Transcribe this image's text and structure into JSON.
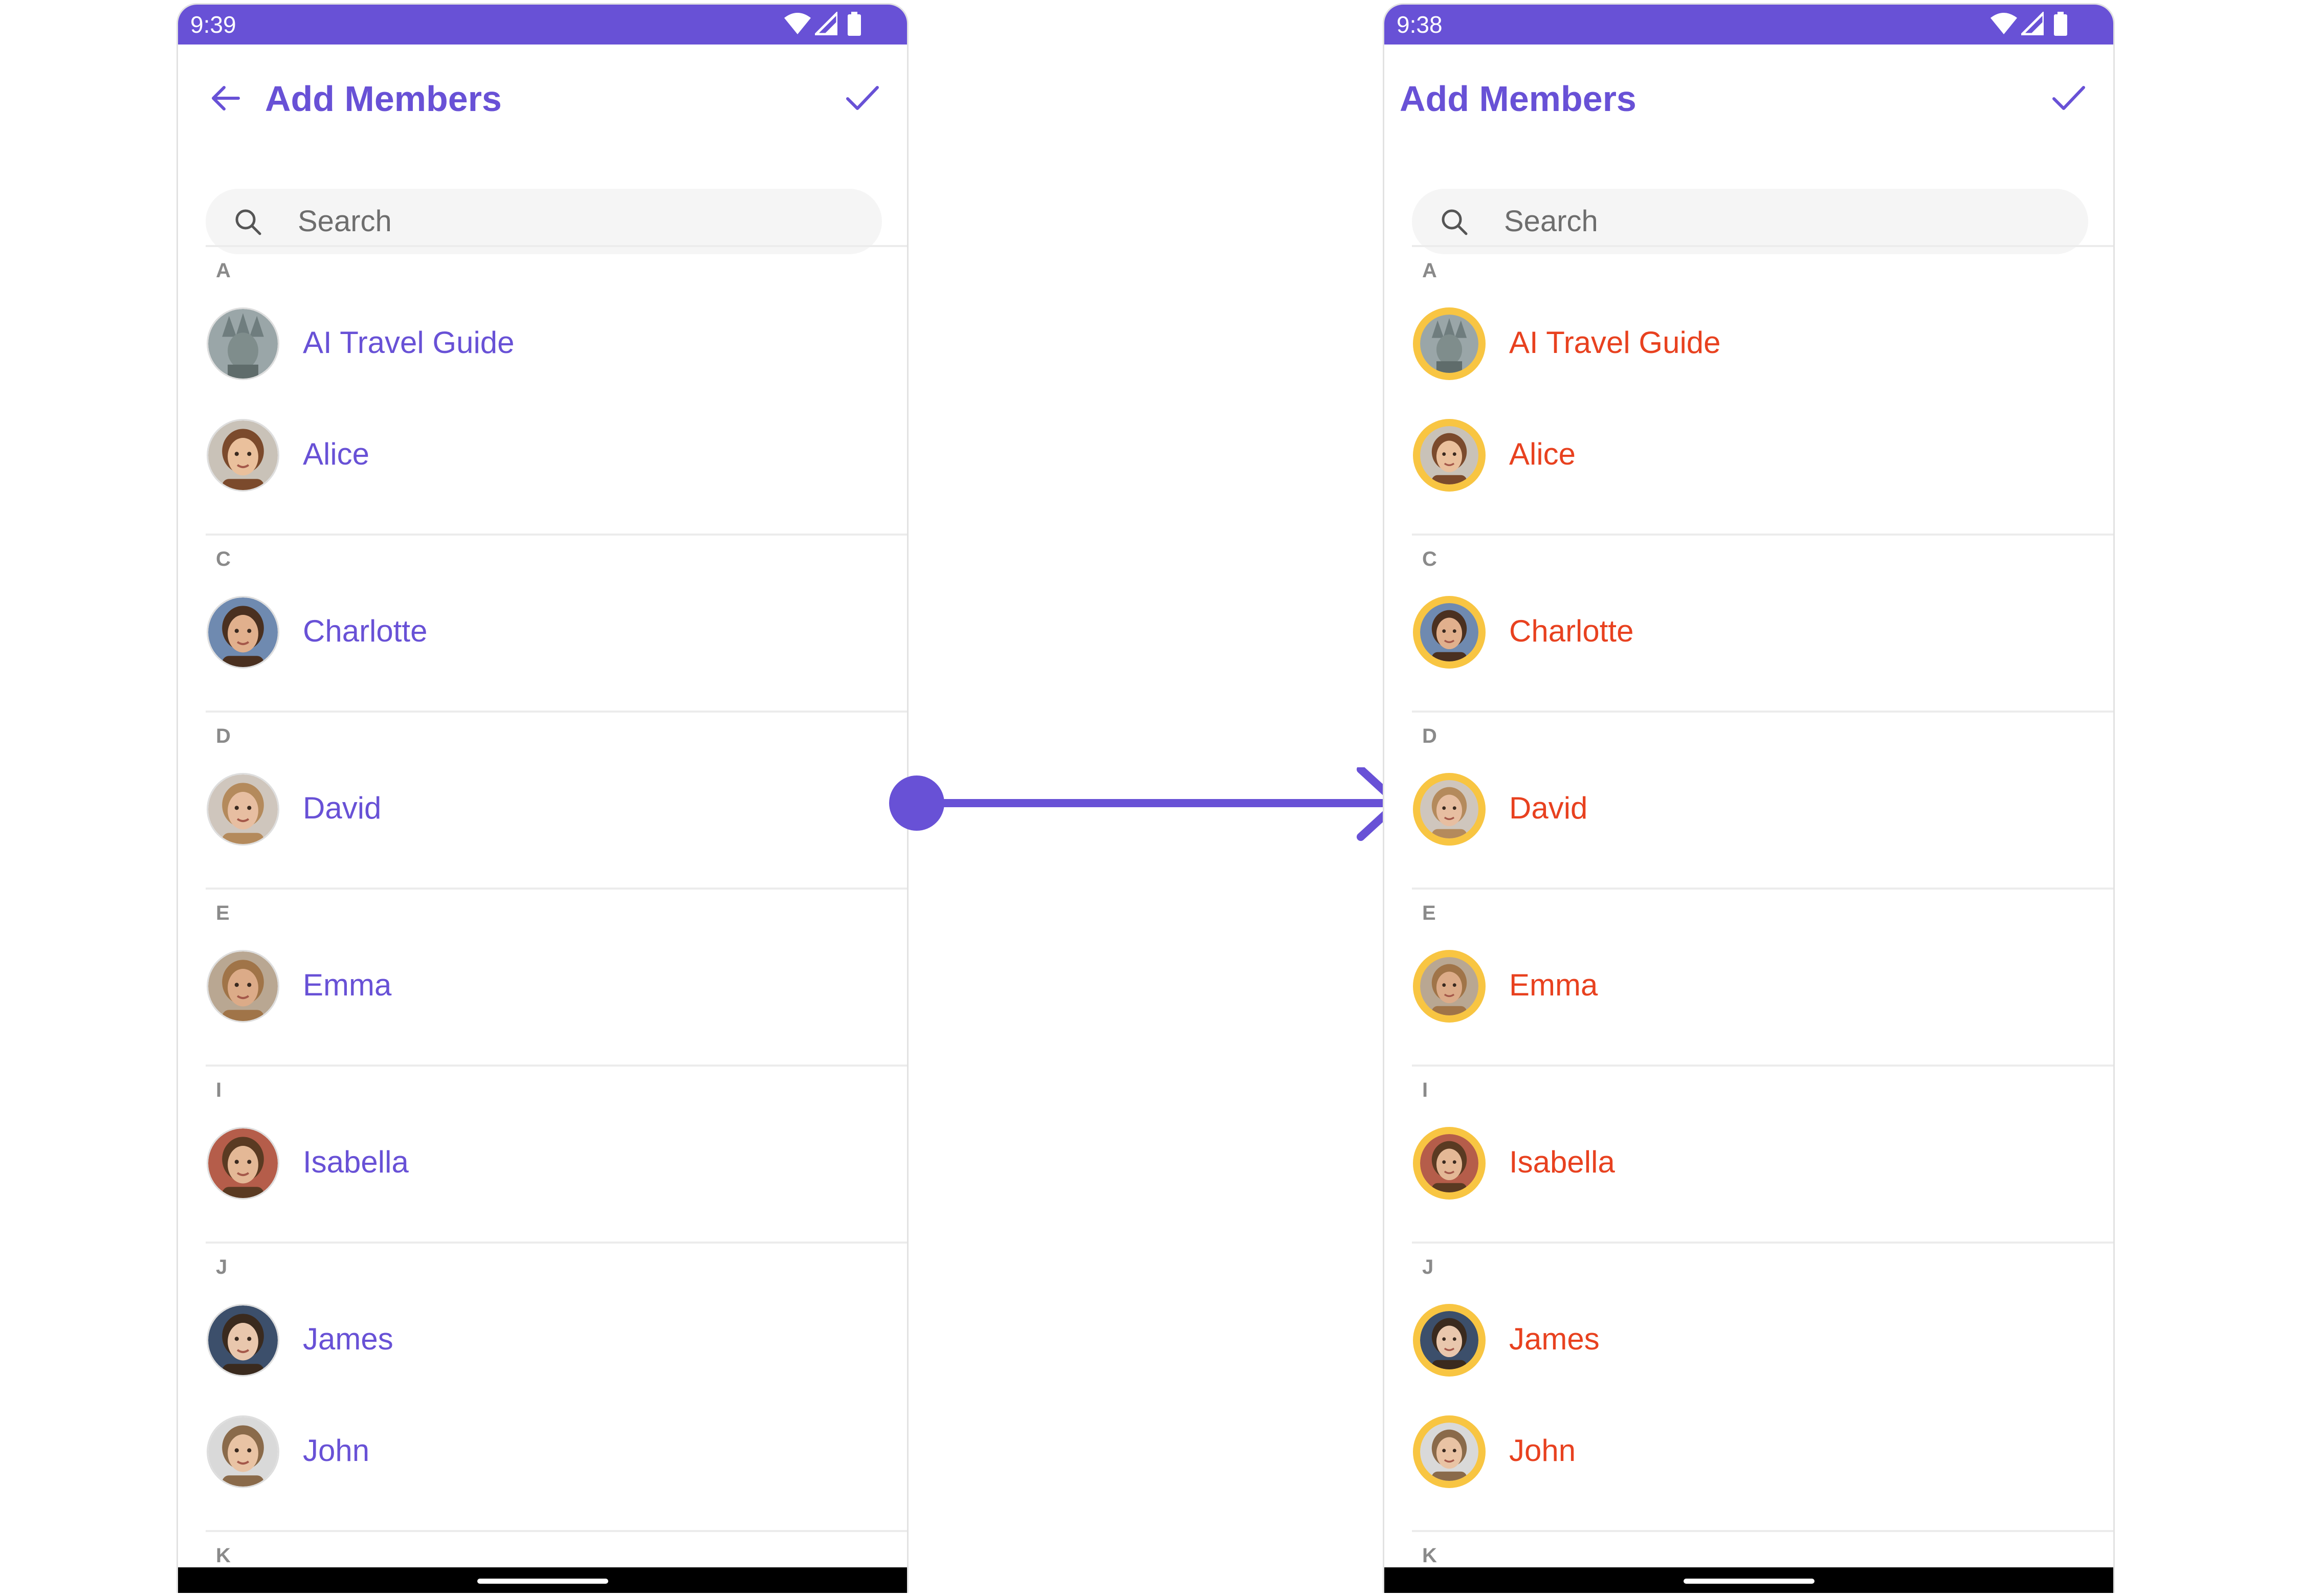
{
  "left_screen": {
    "status_time": "9:39",
    "title": "Add Members",
    "search_placeholder": "Search"
  },
  "right_screen": {
    "status_time": "9:38",
    "title": "Add Members",
    "search_placeholder": "Search"
  },
  "sections": [
    {
      "letter": "A",
      "members": [
        "AI Travel Guide",
        "Alice"
      ]
    },
    {
      "letter": "C",
      "members": [
        "Charlotte"
      ]
    },
    {
      "letter": "D",
      "members": [
        "David"
      ]
    },
    {
      "letter": "E",
      "members": [
        "Emma"
      ]
    },
    {
      "letter": "I",
      "members": [
        "Isabella"
      ]
    },
    {
      "letter": "J",
      "members": [
        "James",
        "John"
      ]
    },
    {
      "letter": "K",
      "members": []
    }
  ],
  "avatar_icons": {
    "AI Travel Guide": "statue-of-liberty-icon",
    "Alice": "avatar-face-icon",
    "Charlotte": "avatar-face-icon",
    "David": "avatar-face-icon",
    "Emma": "avatar-face-icon",
    "Isabella": "avatar-face-icon",
    "James": "avatar-face-icon",
    "John": "avatar-face-icon"
  },
  "colors": {
    "primary": "#6851d6",
    "name_left": "#6851d6",
    "name_right": "#e8411f",
    "avatar_border_right": "#f8c542",
    "divider": "#ececec",
    "section_letter": "#8a8a8a",
    "search_bg": "#f5f5f5"
  }
}
